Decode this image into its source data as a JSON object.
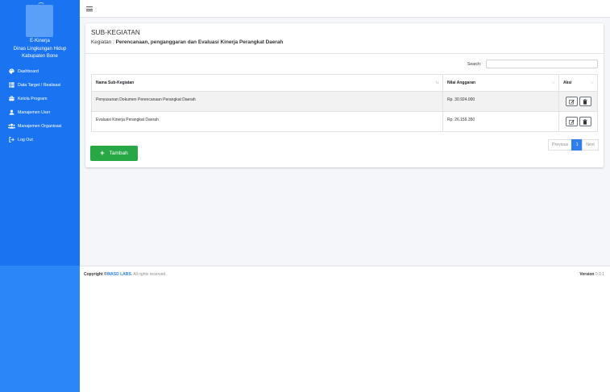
{
  "sidebar": {
    "brand_lines": [
      "E-Kinerja",
      "Dinas Lingkungan Hidup",
      "Kabupaten Bone"
    ],
    "items": [
      {
        "label": "Dashboard",
        "icon": "palette-icon"
      },
      {
        "label": "Data Target / Realisasi",
        "icon": "table-icon"
      },
      {
        "label": "Kelola Program",
        "icon": "briefcase-icon"
      },
      {
        "label": "Manajemen User",
        "icon": "user-icon"
      },
      {
        "label": "Manajemen Organisasi",
        "icon": "users-icon"
      },
      {
        "label": "Log Out",
        "icon": "sign-out-icon"
      }
    ]
  },
  "header": {
    "title": "SUB-KEGIATAN",
    "kegiatan_prefix": "Kegiatan : ",
    "kegiatan_name": "Perencanaan, penganggaran dan Evaluasi Kinerja Perangkat Daerah"
  },
  "search": {
    "label": "Search:",
    "value": ""
  },
  "table": {
    "columns": [
      "Nama Sub-Kegiatan",
      "Nilai Anggaran",
      "Aksi"
    ],
    "rows": [
      {
        "name": "Penyusunan Dokumen Perencanaan Perangkat Daerah",
        "nilai": "Rp. 30.924.000"
      },
      {
        "name": "Evaluasi Kinerja Perangkat Daerah",
        "nilai": "Rp. 26.159.350"
      }
    ]
  },
  "pagination": {
    "previous": "Previous",
    "current": "1",
    "next": "Next"
  },
  "buttons": {
    "tambah": "Tambah"
  },
  "footer": {
    "copyright": "Copyright ©",
    "company": "WASD LABS.",
    "rights": " All rights reserved.",
    "version_label": "Version",
    "version_value": "0.0.1"
  },
  "colors": {
    "sidebar": "#2b86f7",
    "accent": "#2f80ed",
    "success": "#28a745"
  }
}
